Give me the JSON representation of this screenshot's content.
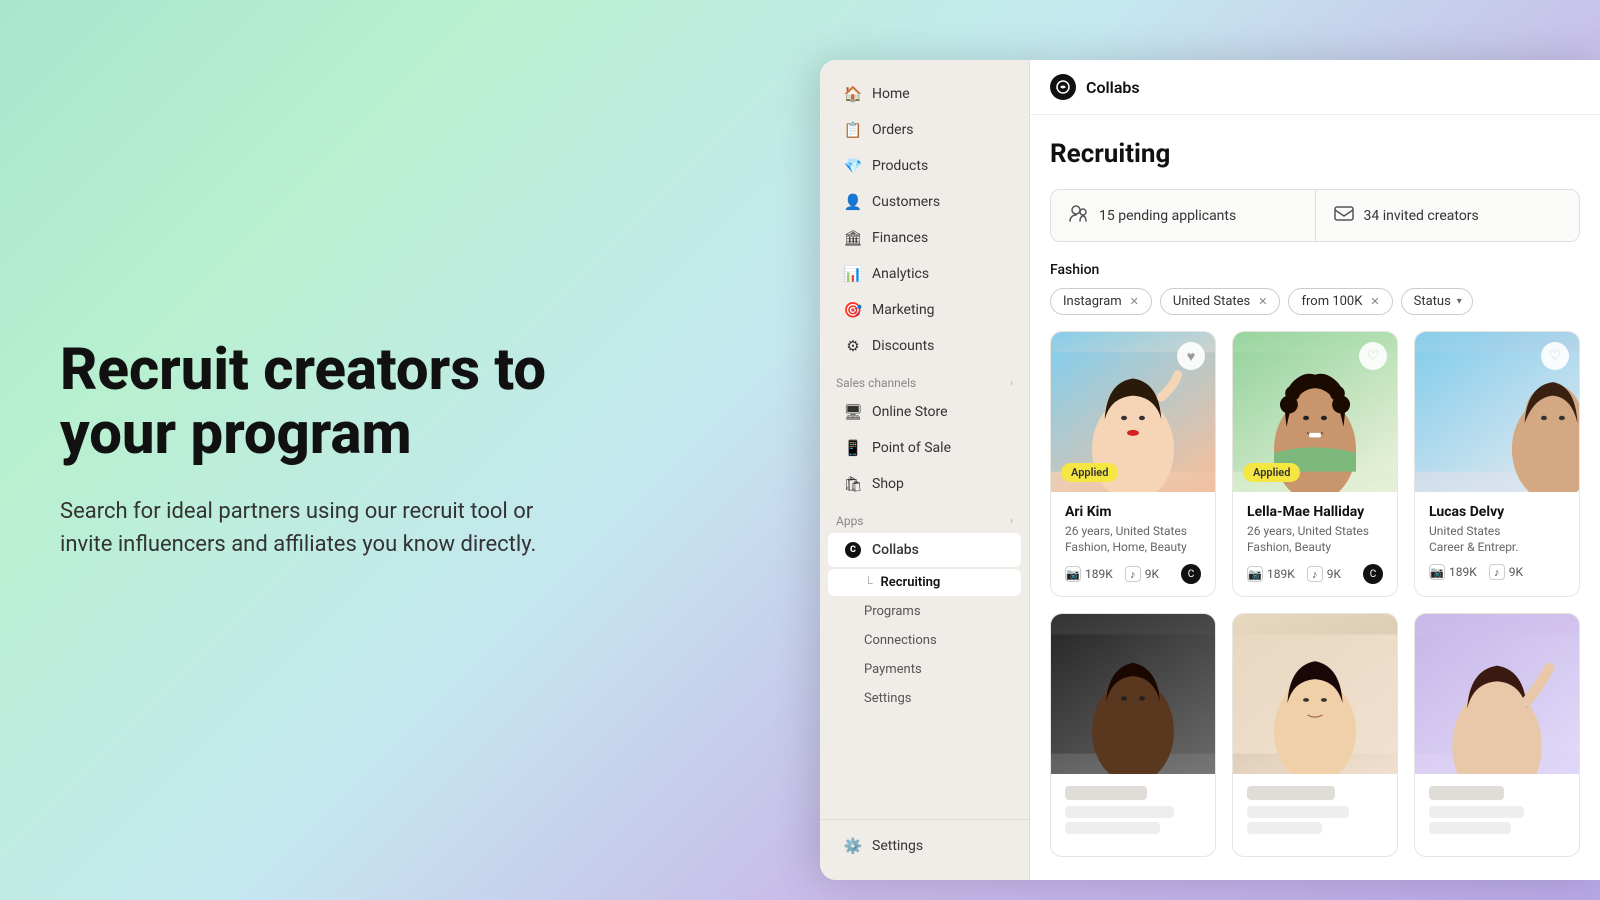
{
  "background": {
    "gradient_start": "#a8e6cf",
    "gradient_end": "#b8a8e8"
  },
  "left_panel": {
    "headline": "Recruit creators to your program",
    "subtext": "Search for ideal partners using our recruit tool or invite influencers and affiliates you know directly."
  },
  "app": {
    "top_bar": {
      "icon_label": "C",
      "title": "Collabs"
    },
    "sidebar": {
      "nav_items": [
        {
          "label": "Home",
          "icon": "🏠"
        },
        {
          "label": "Orders",
          "icon": "📋"
        },
        {
          "label": "Products",
          "icon": "💎"
        },
        {
          "label": "Customers",
          "icon": "👤"
        },
        {
          "label": "Finances",
          "icon": "🏛"
        },
        {
          "label": "Analytics",
          "icon": "📊"
        },
        {
          "label": "Marketing",
          "icon": "🎯"
        },
        {
          "label": "Discounts",
          "icon": "⚙"
        }
      ],
      "sales_channels_label": "Sales channels",
      "sales_channels": [
        {
          "label": "Online Store"
        },
        {
          "label": "Point of Sale"
        },
        {
          "label": "Shop"
        }
      ],
      "apps_label": "Apps",
      "apps": [
        {
          "label": "Collabs"
        }
      ],
      "collabs_subitems": [
        {
          "label": "Recruiting",
          "active": true
        },
        {
          "label": "Programs"
        },
        {
          "label": "Connections"
        },
        {
          "label": "Payments"
        },
        {
          "label": "Settings"
        }
      ],
      "settings_label": "Settings"
    },
    "main": {
      "page_title": "Recruiting",
      "stats": [
        {
          "icon": "👥",
          "label": "15 pending applicants"
        },
        {
          "icon": "💬",
          "label": "34 invited creators"
        }
      ],
      "filter_label": "Fashion",
      "filters": [
        {
          "label": "Instagram",
          "removable": true
        },
        {
          "label": "United States",
          "removable": true
        },
        {
          "label": "from 100K",
          "removable": true
        },
        {
          "label": "Status",
          "dropdown": true
        }
      ],
      "creators": [
        {
          "name": "Ari Kim",
          "age": "26 years",
          "location": "United States",
          "categories": "Fashion, Home, Beauty",
          "instagram": "189K",
          "tiktok": "9K",
          "applied": true,
          "photo_class": "photo-ari"
        },
        {
          "name": "Lella-Mae Halliday",
          "age": "26 years",
          "location": "United States",
          "categories": "Fashion, Beauty",
          "instagram": "189K",
          "tiktok": "9K",
          "applied": true,
          "photo_class": "photo-lella"
        },
        {
          "name": "Lucas Delvy",
          "age": "",
          "location": "United States",
          "categories": "Career & Entrepr.",
          "instagram": "189K",
          "tiktok": "9K",
          "applied": false,
          "photo_class": "photo-lucas"
        },
        {
          "name": "",
          "age": "",
          "location": "",
          "categories": "",
          "instagram": "",
          "tiktok": "",
          "applied": false,
          "photo_class": "photo-row2a"
        },
        {
          "name": "",
          "age": "",
          "location": "",
          "categories": "",
          "instagram": "",
          "tiktok": "",
          "applied": false,
          "photo_class": "photo-row2b"
        },
        {
          "name": "",
          "age": "",
          "location": "",
          "categories": "",
          "instagram": "",
          "tiktok": "",
          "applied": false,
          "photo_class": "photo-row2c"
        }
      ]
    }
  }
}
